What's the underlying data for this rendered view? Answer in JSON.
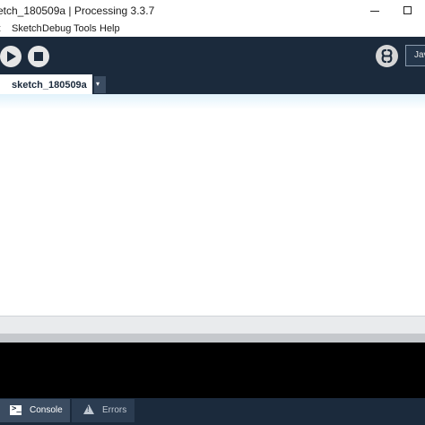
{
  "window": {
    "title": "etch_180509a | Processing 3.3.7"
  },
  "menu": {
    "items": [
      "it",
      "Sketch",
      "Debug",
      "Tools",
      "Help"
    ]
  },
  "toolbar": {
    "mode_label": "Jav"
  },
  "tabs": {
    "active_label": "sketch_180509a",
    "menu_glyph": "▾"
  },
  "footer": {
    "console_label": "Console",
    "errors_label": "Errors",
    "console_icon_glyph": ">_"
  },
  "colors": {
    "toolbar_bg": "#1b2a3c",
    "console_bg": "#000000",
    "editor_bg": "#ffffff"
  }
}
